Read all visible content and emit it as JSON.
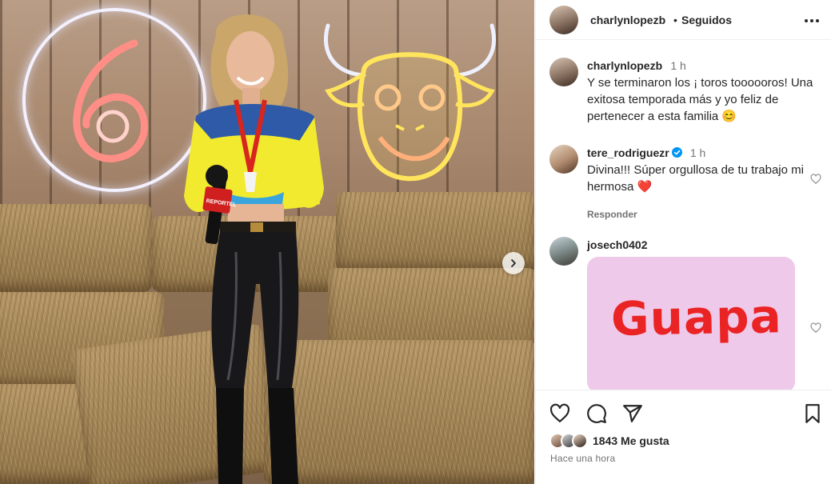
{
  "post": {
    "username": "charlynlopezb",
    "separator": "•",
    "follow_status": "Seguidos"
  },
  "comments": [
    {
      "username": "charlynlopezb",
      "time": "1 h",
      "text": "Y se terminaron los ¡ toros toooooros! Una exitosa temporada más y yo feliz de pertenecer a esta familia 😊"
    },
    {
      "username": "tere_rodriguezr",
      "verified": true,
      "time": "1 h",
      "text": "Divina!!! Súper orgullosa de tu trabajo mi hermosa ❤️",
      "reply_label": "Responder"
    },
    {
      "username": "josech0402",
      "sticker_text": "Guapa",
      "sticker_color": "#efc9e9",
      "sticker_text_color": "#ea2424"
    }
  ],
  "photo": {
    "mic_label": "REPORTEL"
  },
  "actions": {
    "like_icon": "heart-icon",
    "comment_icon": "comment-icon",
    "share_icon": "share-icon",
    "save_icon": "bookmark-icon"
  },
  "likes": {
    "count_text": "1843 Me gusta"
  },
  "timestamp": "Hace una hora",
  "colors": {
    "text": "#262626",
    "secondary": "#737373",
    "verified": "#0095f6",
    "heart": "#ed4956"
  }
}
